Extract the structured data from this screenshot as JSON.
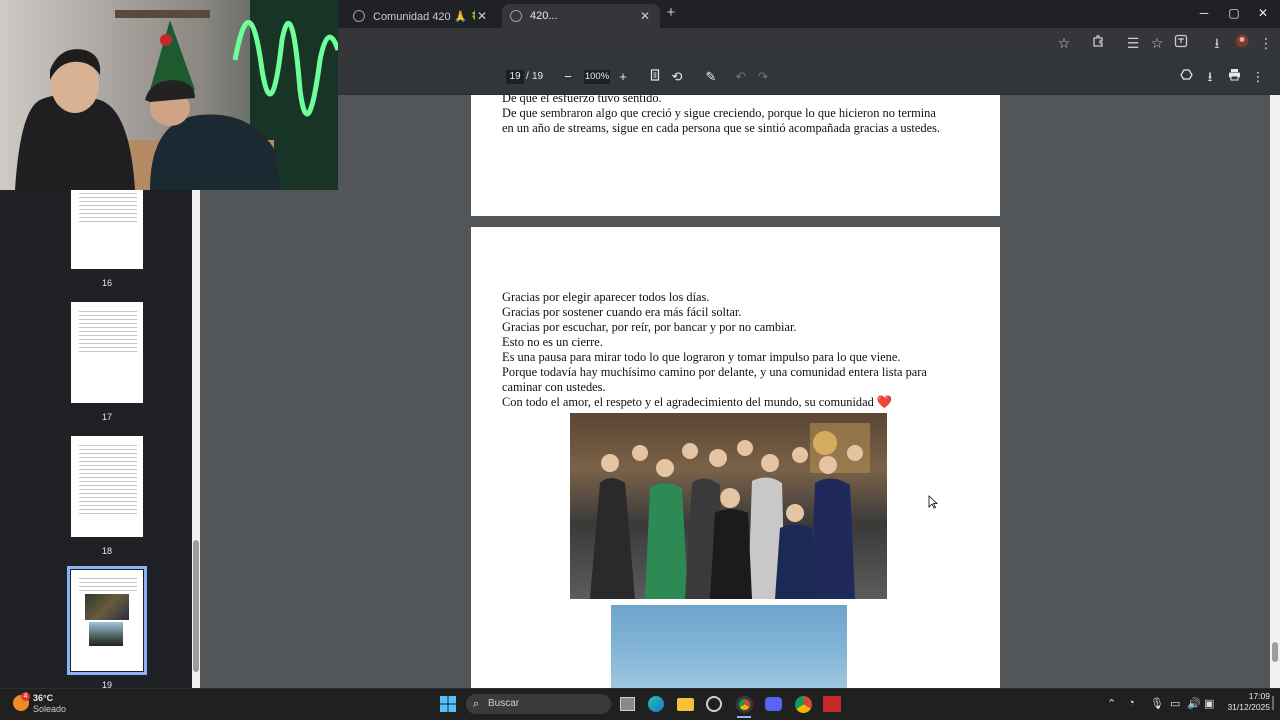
{
  "browser": {
    "tabs": [
      {
        "title": "Comunidad 420 🙏 🍀"
      },
      {
        "title": "420..."
      }
    ],
    "new_tab_glyph": "+",
    "window_controls": [
      "─",
      "▢",
      "✕"
    ]
  },
  "pdf": {
    "current_page": "19",
    "separator": "/",
    "total_pages": "19",
    "zoom": "100%",
    "thumbnail_labels": [
      "16",
      "17",
      "18",
      "19"
    ],
    "top_page_lines": [
      "De que el esfuerzo tuvo sentido.",
      "De que sembraron algo que creció y sigue creciendo, porque lo que hicieron no termina",
      "en un año de streams, sigue en cada persona que se sintió acompañada gracias a ustedes."
    ],
    "page_lines": [
      "Gracias por elegir aparecer todos los días.",
      "Gracias por sostener cuando era más fácil soltar.",
      "Gracias por escuchar, por reír, por bancar y por no cambiar.",
      "Esto no es un cierre.",
      "Es una pausa para mirar todo lo que lograron y tomar impulso para lo que viene.",
      "Porque todavía hay muchísimo camino por delante, y una comunidad entera lista para",
      "caminar con ustedes.",
      "Con todo el amor, el respeto y el agradecimiento del mundo, su comunidad ❤️"
    ]
  },
  "taskbar": {
    "weather_temp": "36°C",
    "weather_desc": "Soleado",
    "weather_badge": "4",
    "search_placeholder": "Buscar",
    "time": "17:09",
    "date": "31/12/2025"
  },
  "colors": {
    "accent": "#8ab4f8",
    "viewer_bg": "#525659",
    "toolbar_bg": "#323639",
    "taskbar_bg": "#202020"
  }
}
